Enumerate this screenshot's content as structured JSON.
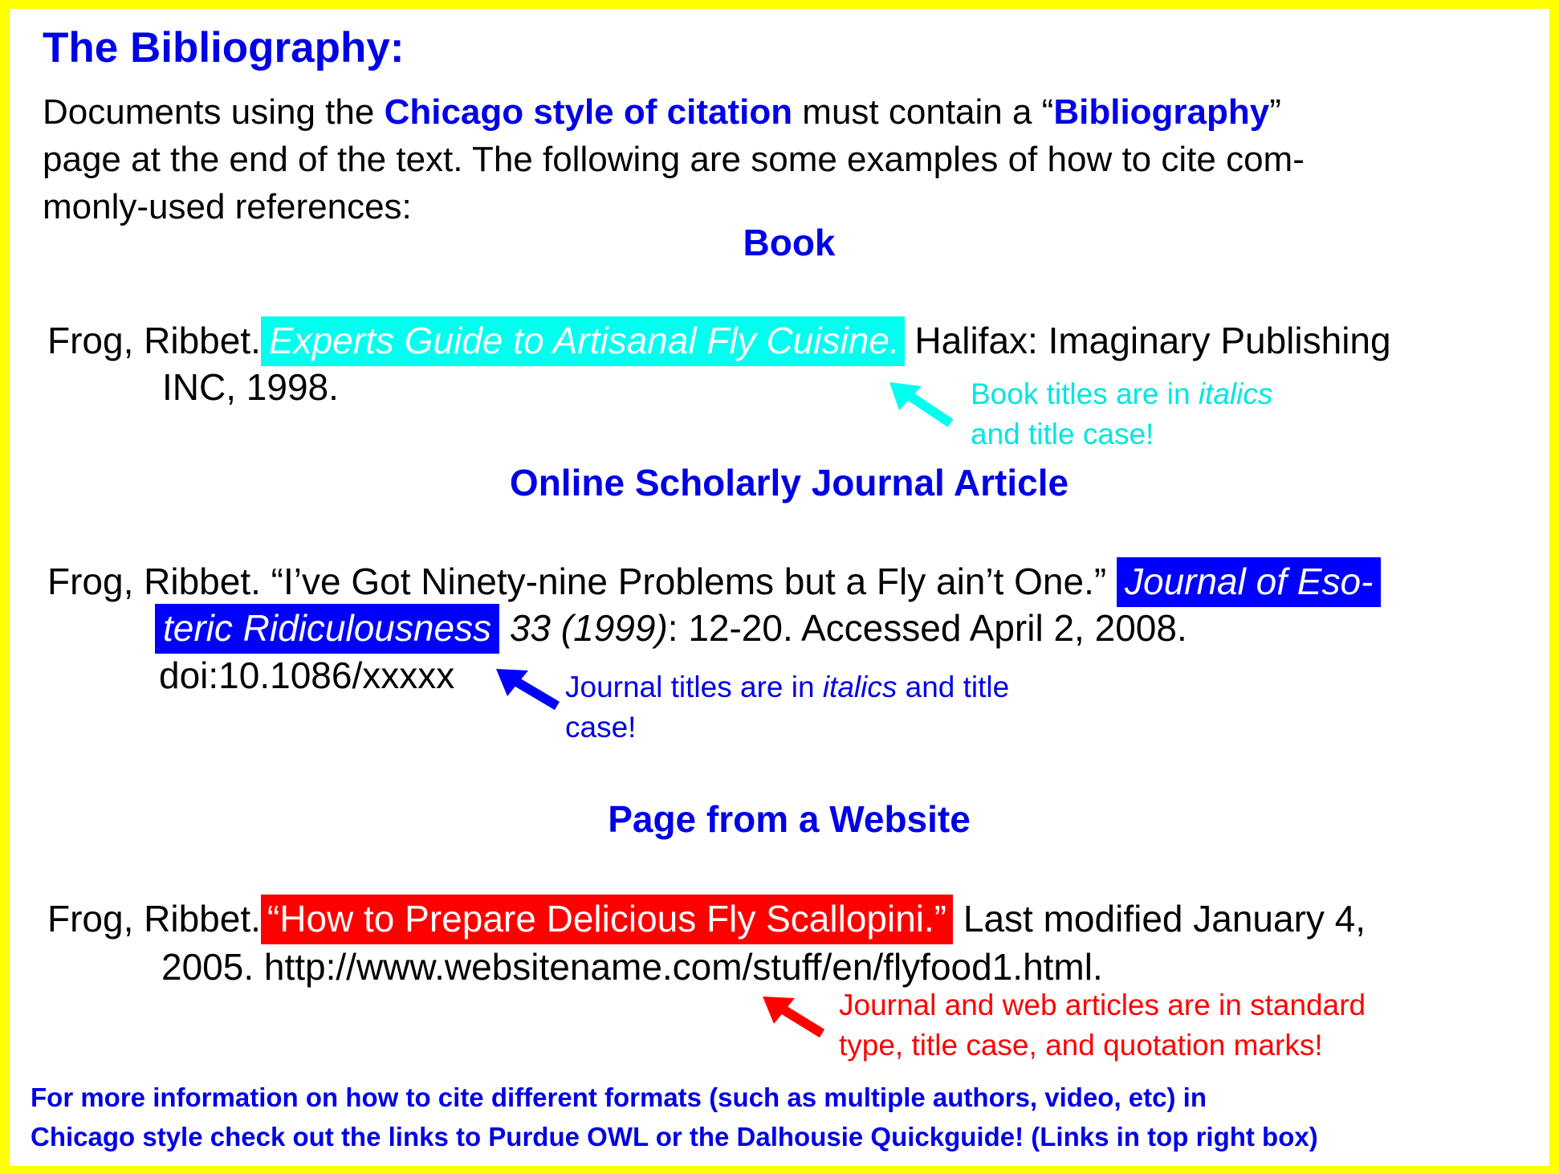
{
  "title": "The Bibliography:",
  "intro": {
    "line1_pre": "Documents using the ",
    "line1_em": "Chicago style of citation",
    "line1_mid": " must contain a “",
    "line1_em2": "Bibliography",
    "line1_post": "”",
    "line2": "page at the end of the text.  The following are some examples of how to cite com-",
    "line3": "monly-used references:"
  },
  "sections": {
    "book": {
      "heading": "Book",
      "author": "Frog, Ribbet.",
      "title": "Experts Guide to Artisanal Fly Cuisine.",
      "rest_line1": " Halifax: Imaginary Publishing",
      "line2": "INC, 1998.",
      "note_line1_pre": "Book titles are in ",
      "note_line1_em": "italics",
      "note_line2": "and title case!",
      "note_color": "#00e6e0",
      "highlight_color": "#00ffef"
    },
    "journal": {
      "heading": "Online Scholarly Journal Article",
      "line1_pre": "Frog, Ribbet. “I’ve Got Ninety-nine Problems but a Fly ain’t One.” ",
      "journal_part1": "Journal of Eso-",
      "journal_part2": "teric Ridiculousness",
      "volume_year": " 33 (1999)",
      "line2_post": ": 12-20.  Accessed April 2, 2008.",
      "line3": "doi:10.1086/xxxxx",
      "note_line1_pre": "Journal titles are in ",
      "note_line1_em": "italics",
      "note_line1_post": " and title",
      "note_line2": "case!",
      "note_color": "#0000e6",
      "highlight_color": "#0000ff"
    },
    "website": {
      "heading": "Page from a Website",
      "author": "Frog, Ribbet.",
      "title": "“How to Prepare Delicious Fly Scallopini.”",
      "rest_line1": " Last modified January 4,",
      "line2": "2005. http://www.websitename.com/stuff/en/flyfood1.html.",
      "note_line1": "Journal and web articles are in standard",
      "note_line2": "type, title case, and quotation marks!",
      "note_color": "#ff0000",
      "highlight_color": "#ff0000"
    }
  },
  "footer": {
    "line1": "For more information on how to cite different formats (such as multiple authors, video, etc) in",
    "line2": "Chicago style check out the links to Purdue OWL or the Dalhousie Quickguide! (Links in top right box)"
  },
  "colors": {
    "border": "#ffff00",
    "accent_blue": "#0000e6"
  }
}
